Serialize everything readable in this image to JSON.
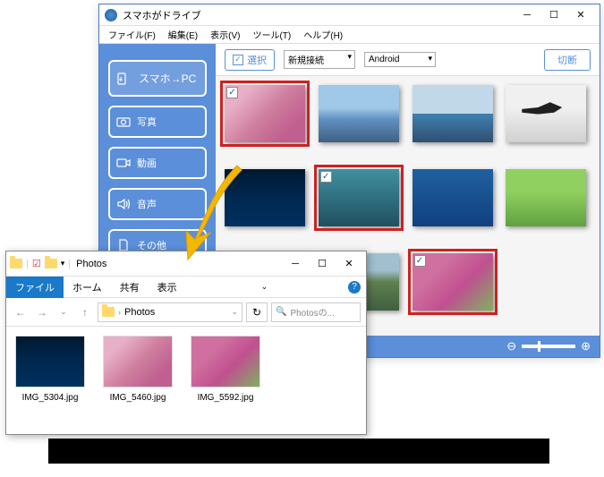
{
  "app": {
    "title": "スマホがドライブ",
    "menus": [
      "ファイル(F)",
      "編集(E)",
      "表示(V)",
      "ツール(T)",
      "ヘルプ(H)"
    ],
    "sidebar": {
      "main": "スマホ→PC",
      "items": [
        "写真",
        "動画",
        "音声",
        "その他"
      ]
    },
    "toolbar": {
      "select": "選択",
      "dd1": "新規接続",
      "dd2": "Android",
      "disconnect": "切断"
    }
  },
  "explorer": {
    "title": "Photos",
    "tabs": {
      "file": "ファイル",
      "home": "ホーム",
      "share": "共有",
      "view": "表示"
    },
    "path": "Photos",
    "search_placeholder": "Photosの...",
    "files": [
      "IMG_5304.jpg",
      "IMG_5460.jpg",
      "IMG_5592.jpg"
    ]
  }
}
